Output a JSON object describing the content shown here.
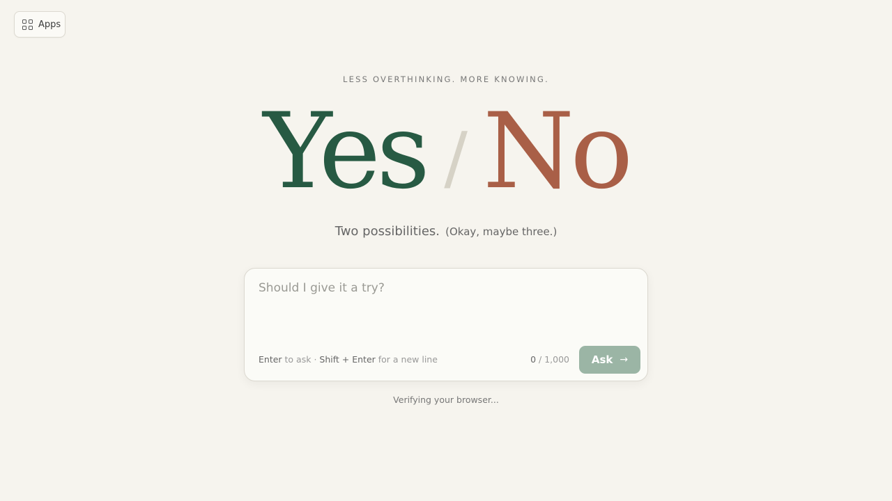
{
  "apps_button": {
    "label": "Apps",
    "icon": "grid-icon"
  },
  "tagline": "LESS OVERTHINKING. MORE KNOWING.",
  "hero": {
    "yes": "Yes",
    "separator": "/",
    "no": "No"
  },
  "colors": {
    "yes": "#275a43",
    "no": "#a95f47",
    "ask_button": "#9bb5a5",
    "background": "#f6f4ee"
  },
  "subtitle": {
    "main": "Two possibilities.",
    "aside": "(Okay, maybe three.)"
  },
  "ask_form": {
    "placeholder": "Should I give it a try?",
    "value": "",
    "hint": {
      "key1": "Enter",
      "text1": " to ask · ",
      "key2": "Shift + Enter",
      "text2": " for a new line"
    },
    "counter": {
      "current": "0",
      "max": " / 1,000"
    },
    "ask_label": "Ask",
    "ask_icon": "arrow-right-icon"
  },
  "status": "Verifying your browser..."
}
